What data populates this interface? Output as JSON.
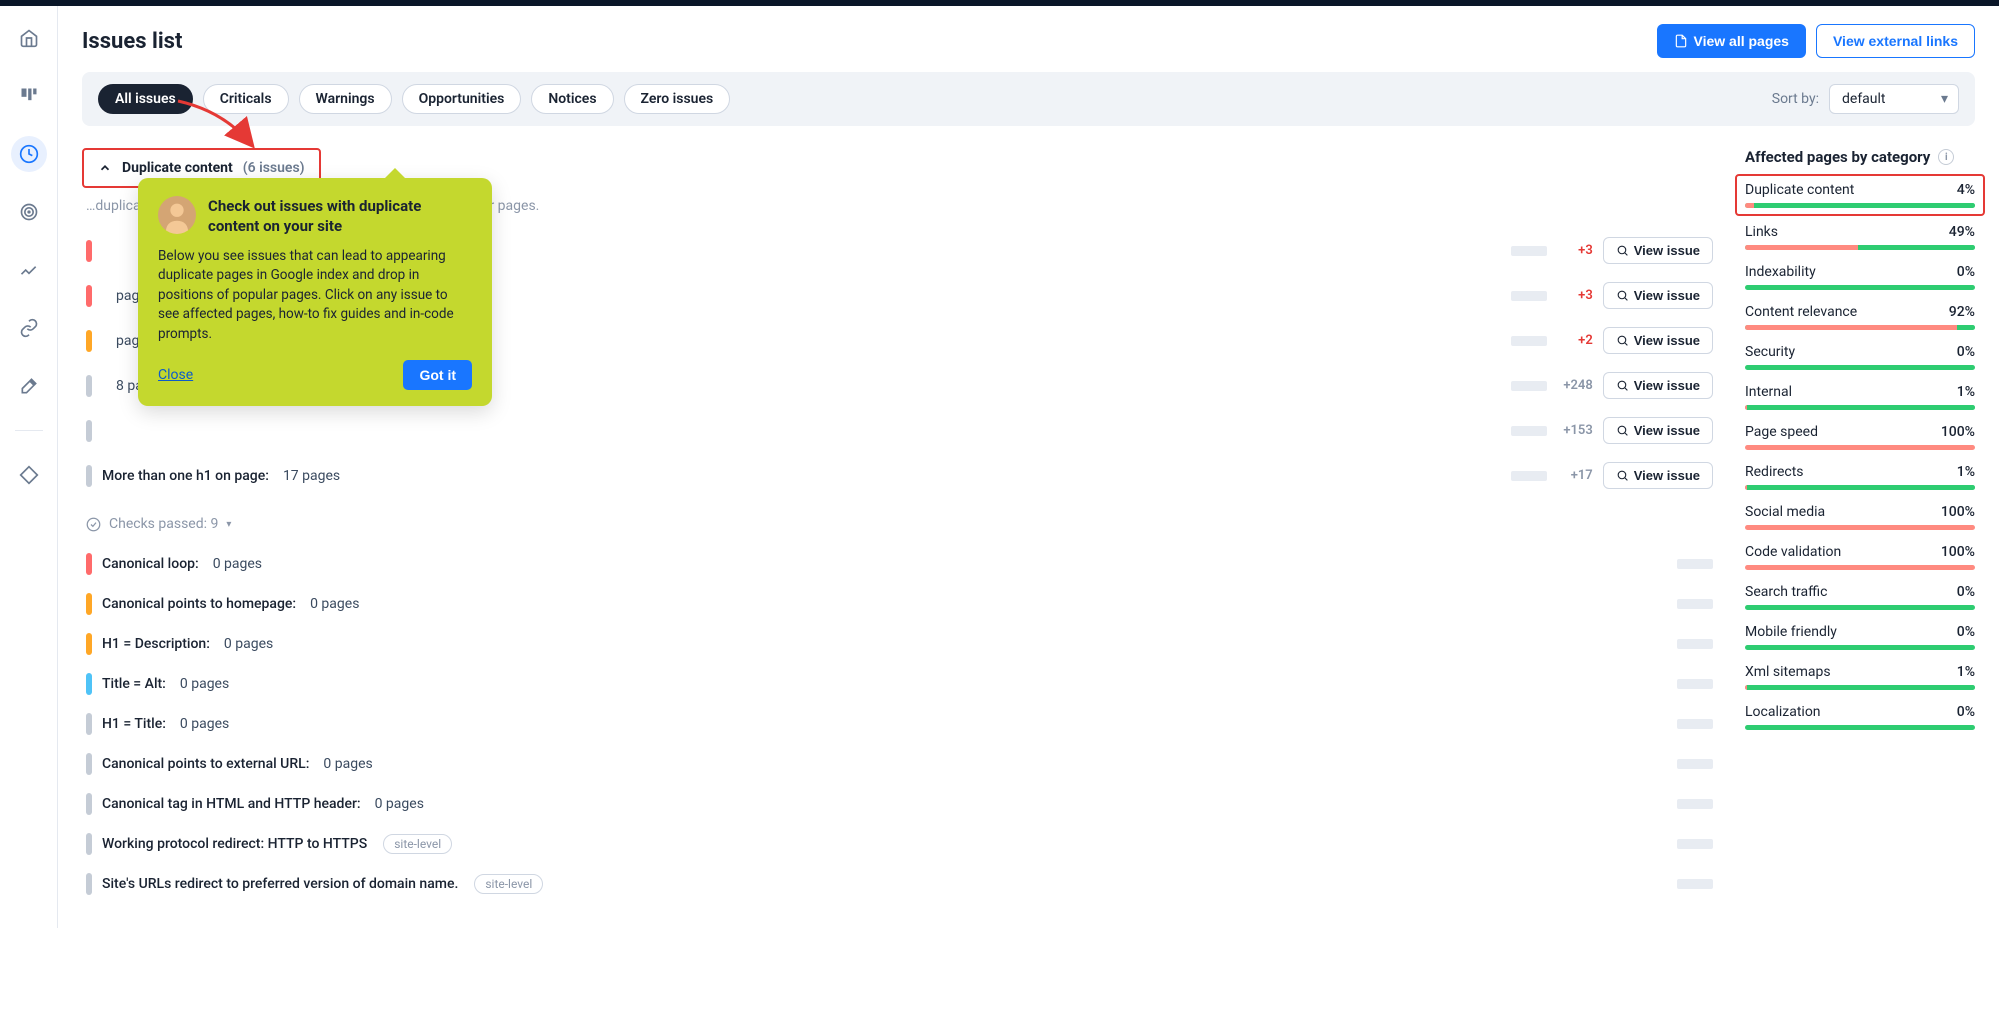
{
  "page": {
    "title": "Issues list"
  },
  "header_buttons": {
    "view_all_pages": "View all pages",
    "view_external_links": "View external links"
  },
  "filters": {
    "pills": [
      "All issues",
      "Criticals",
      "Warnings",
      "Opportunities",
      "Notices",
      "Zero issues"
    ],
    "sort_label": "Sort by:",
    "sort_value": "default"
  },
  "accordion": {
    "title": "Duplicate content",
    "count": "(6 issues)",
    "description": "…duplicate pages in Google index and drop in positions of popular pages."
  },
  "issues_with_delta": [
    {
      "label": "",
      "pages": "",
      "delta": "+3",
      "delta_color": "red",
      "severity": "red"
    },
    {
      "label": "",
      "pages": "pages",
      "delta": "+3",
      "delta_color": "red",
      "severity": "red"
    },
    {
      "label": "",
      "pages": "pages",
      "delta": "+2",
      "delta_color": "red",
      "severity": "orange"
    },
    {
      "label": "",
      "pages": "8 pages",
      "delta": "+248",
      "delta_color": "gray",
      "severity": "gray"
    },
    {
      "label": "",
      "pages": "",
      "delta": "+153",
      "delta_color": "gray",
      "severity": "gray"
    },
    {
      "label": "More than one h1 on page:",
      "pages": "17 pages",
      "delta": "+17",
      "delta_color": "gray",
      "severity": "gray"
    }
  ],
  "view_issue_label": "View issue",
  "checks_passed": {
    "label": "Checks passed: 9",
    "caret": "▾"
  },
  "passed_issues": [
    {
      "label": "Canonical loop:",
      "pages": "0 pages",
      "severity": "red"
    },
    {
      "label": "Canonical points to homepage:",
      "pages": "0 pages",
      "severity": "orange"
    },
    {
      "label": "H1 = Description:",
      "pages": "0 pages",
      "severity": "orange"
    },
    {
      "label": "Title = Alt:",
      "pages": "0 pages",
      "severity": "blue"
    },
    {
      "label": "H1 = Title:",
      "pages": "0 pages",
      "severity": "gray"
    },
    {
      "label": "Canonical points to external URL:",
      "pages": "0 pages",
      "severity": "gray"
    },
    {
      "label": "Canonical tag in HTML and HTTP header:",
      "pages": "0 pages",
      "severity": "gray"
    },
    {
      "label": "Working protocol redirect: HTTP to HTTPS",
      "pages": "",
      "severity": "gray",
      "site_level": true
    },
    {
      "label": "Site's URLs redirect to preferred version of domain name.",
      "pages": "",
      "severity": "gray",
      "site_level": true
    }
  ],
  "site_level_label": "site-level",
  "side_panel": {
    "title": "Affected pages by category",
    "categories": [
      {
        "name": "Duplicate content",
        "pct": "4%",
        "fill": 4,
        "highlighted": true
      },
      {
        "name": "Links",
        "pct": "49%",
        "fill": 49
      },
      {
        "name": "Indexability",
        "pct": "0%",
        "fill": 0
      },
      {
        "name": "Content relevance",
        "pct": "92%",
        "fill": 92
      },
      {
        "name": "Security",
        "pct": "0%",
        "fill": 0
      },
      {
        "name": "Internal",
        "pct": "1%",
        "fill": 1
      },
      {
        "name": "Page speed",
        "pct": "100%",
        "fill": 100
      },
      {
        "name": "Redirects",
        "pct": "1%",
        "fill": 1
      },
      {
        "name": "Social media",
        "pct": "100%",
        "fill": 100
      },
      {
        "name": "Code validation",
        "pct": "100%",
        "fill": 100
      },
      {
        "name": "Search traffic",
        "pct": "0%",
        "fill": 0
      },
      {
        "name": "Mobile friendly",
        "pct": "0%",
        "fill": 0
      },
      {
        "name": "Xml sitemaps",
        "pct": "1%",
        "fill": 1
      },
      {
        "name": "Localization",
        "pct": "0%",
        "fill": 0
      }
    ]
  },
  "tooltip": {
    "title": "Check out issues with duplicate content on your site",
    "body": "Below you see issues that can lead to appearing duplicate pages in Google index and drop in positions of popular pages. Click on any issue to see affected pages, how-to fix guides and in-code prompts.",
    "close": "Close",
    "got_it": "Got it"
  }
}
